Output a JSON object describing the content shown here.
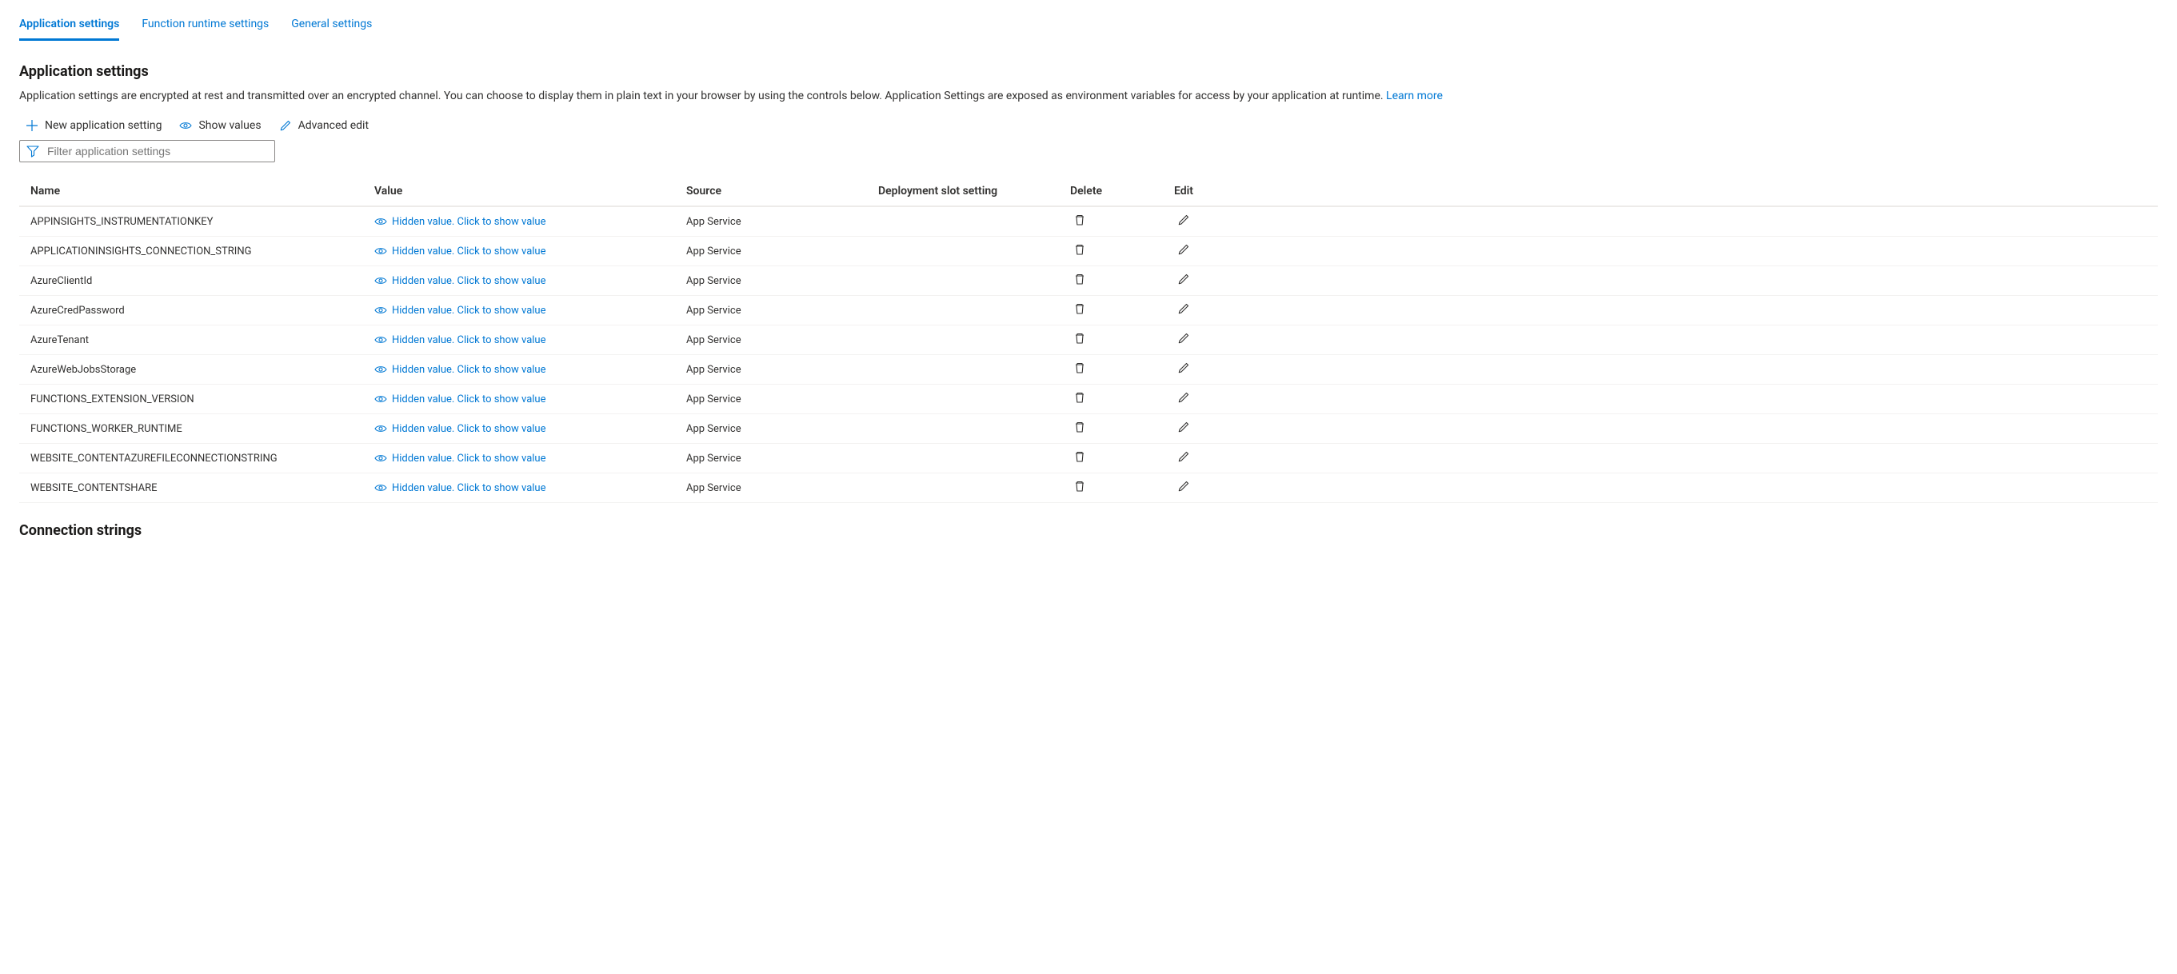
{
  "tabs": [
    {
      "label": "Application settings",
      "active": true
    },
    {
      "label": "Function runtime settings",
      "active": false
    },
    {
      "label": "General settings",
      "active": false
    }
  ],
  "section": {
    "title": "Application settings",
    "description_pre": "Application settings are encrypted at rest and transmitted over an encrypted channel. You can choose to display them in plain text in your browser by using the controls below. Application Settings are exposed as environment variables for access by your application at runtime. ",
    "learn_more": "Learn more"
  },
  "toolbar": {
    "new_setting": "New application setting",
    "show_values": "Show values",
    "advanced_edit": "Advanced edit"
  },
  "filter": {
    "placeholder": "Filter application settings"
  },
  "columns": {
    "name": "Name",
    "value": "Value",
    "source": "Source",
    "slot": "Deployment slot setting",
    "delete": "Delete",
    "edit": "Edit"
  },
  "hidden_value_text": "Hidden value. Click to show value",
  "rows": [
    {
      "name": "APPINSIGHTS_INSTRUMENTATIONKEY",
      "source": "App Service"
    },
    {
      "name": "APPLICATIONINSIGHTS_CONNECTION_STRING",
      "source": "App Service"
    },
    {
      "name": "AzureClientId",
      "source": "App Service"
    },
    {
      "name": "AzureCredPassword",
      "source": "App Service"
    },
    {
      "name": "AzureTenant",
      "source": "App Service"
    },
    {
      "name": "AzureWebJobsStorage",
      "source": "App Service"
    },
    {
      "name": "FUNCTIONS_EXTENSION_VERSION",
      "source": "App Service"
    },
    {
      "name": "FUNCTIONS_WORKER_RUNTIME",
      "source": "App Service"
    },
    {
      "name": "WEBSITE_CONTENTAZUREFILECONNECTIONSTRING",
      "source": "App Service"
    },
    {
      "name": "WEBSITE_CONTENTSHARE",
      "source": "App Service"
    }
  ],
  "connection_strings": {
    "title": "Connection strings"
  }
}
